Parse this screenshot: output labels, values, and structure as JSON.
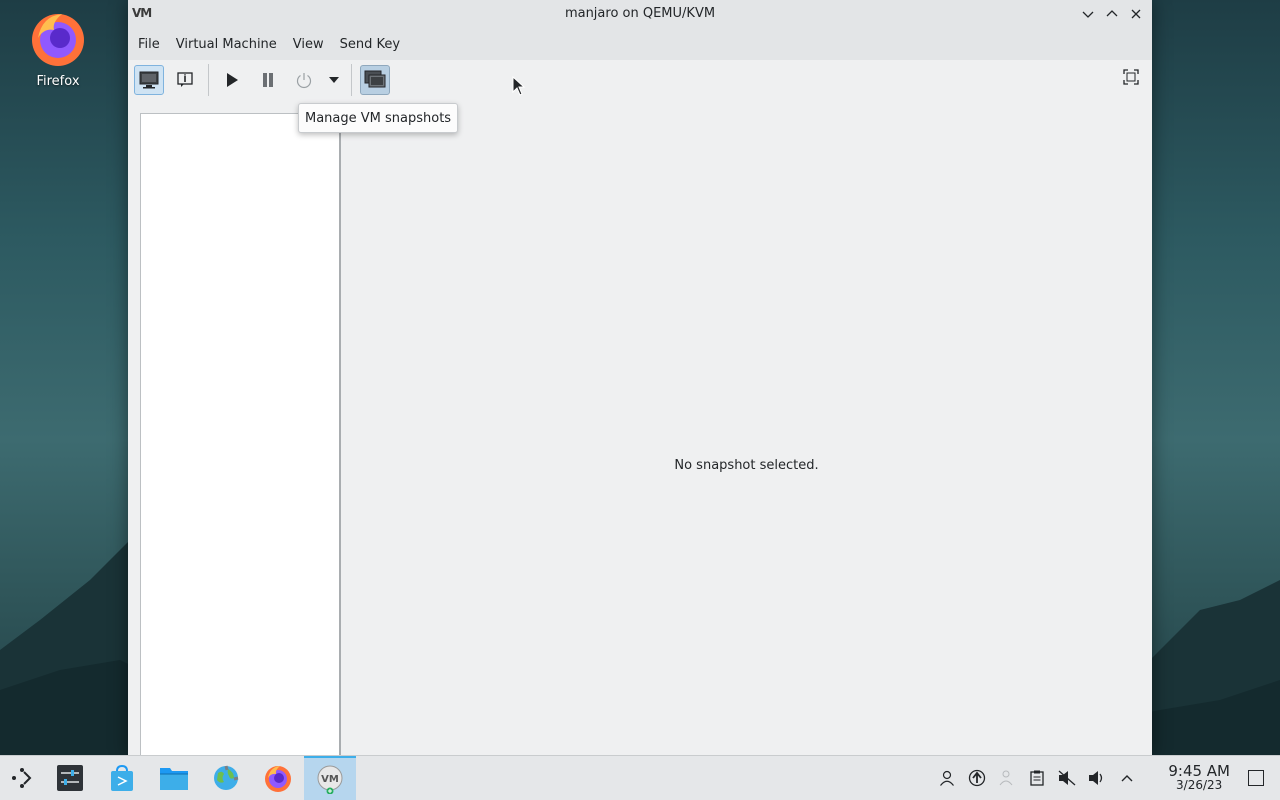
{
  "desktop": {
    "icons": [
      {
        "label": "Firefox",
        "icon": "firefox-icon"
      }
    ]
  },
  "window": {
    "title": "manjaro on QEMU/KVM",
    "app_icon_text": "VM",
    "menu": [
      "File",
      "Virtual Machine",
      "View",
      "Send Key"
    ],
    "toolbar": {
      "buttons": [
        "console-icon",
        "details-icon",
        "run-icon",
        "pause-icon",
        "shutdown-icon",
        "shutdown-menu-icon",
        "snapshots-icon",
        "fullscreen-icon"
      ],
      "active_button": "snapshots-icon"
    },
    "tooltip": "Manage VM snapshots",
    "empty_message": "No snapshot selected."
  },
  "taskbar": {
    "apps": [
      "application-launcher-icon",
      "system-settings-icon",
      "software-store-icon",
      "file-manager-icon",
      "browser-globe-icon",
      "firefox-icon",
      "virt-manager-icon"
    ],
    "active_app": "virt-manager-icon",
    "tray": [
      "user-icon",
      "updates-icon",
      "network-icon",
      "clipboard-icon",
      "mute-icon",
      "volume-icon",
      "expand-tray-icon"
    ],
    "clock": {
      "time": "9:45 AM",
      "date": "3/26/23"
    }
  },
  "colors": {
    "accent": "#3daee9",
    "window_bg": "#eff0f1",
    "taskbar_bg": "#e5e7e9"
  }
}
